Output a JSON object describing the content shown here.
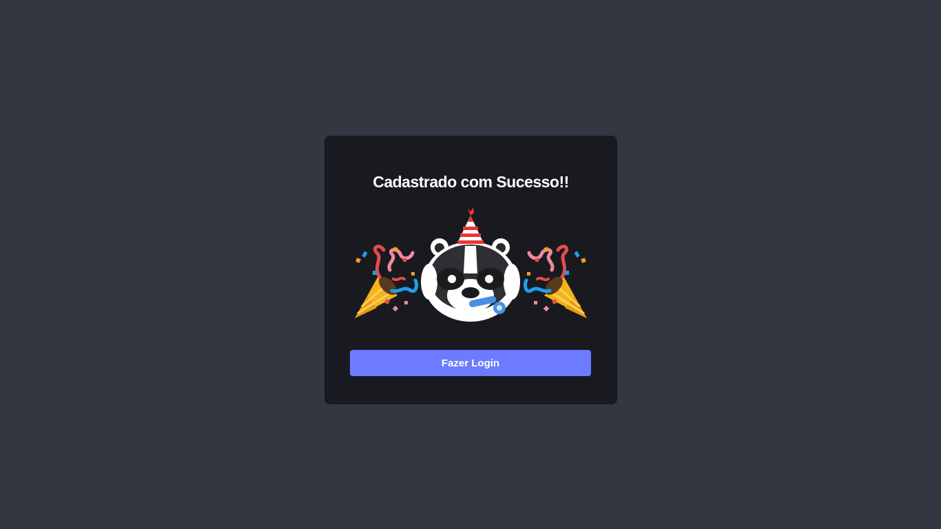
{
  "card": {
    "title": "Cadastrado com Sucesso!!",
    "illustration_icons": [
      "party-popper-icon",
      "raccoon-party-icon",
      "party-popper-icon"
    ],
    "button_label": "Fazer Login"
  },
  "colors": {
    "background": "#343741",
    "card": "#191a20",
    "button": "#6c7bff",
    "text": "#ffffff"
  }
}
